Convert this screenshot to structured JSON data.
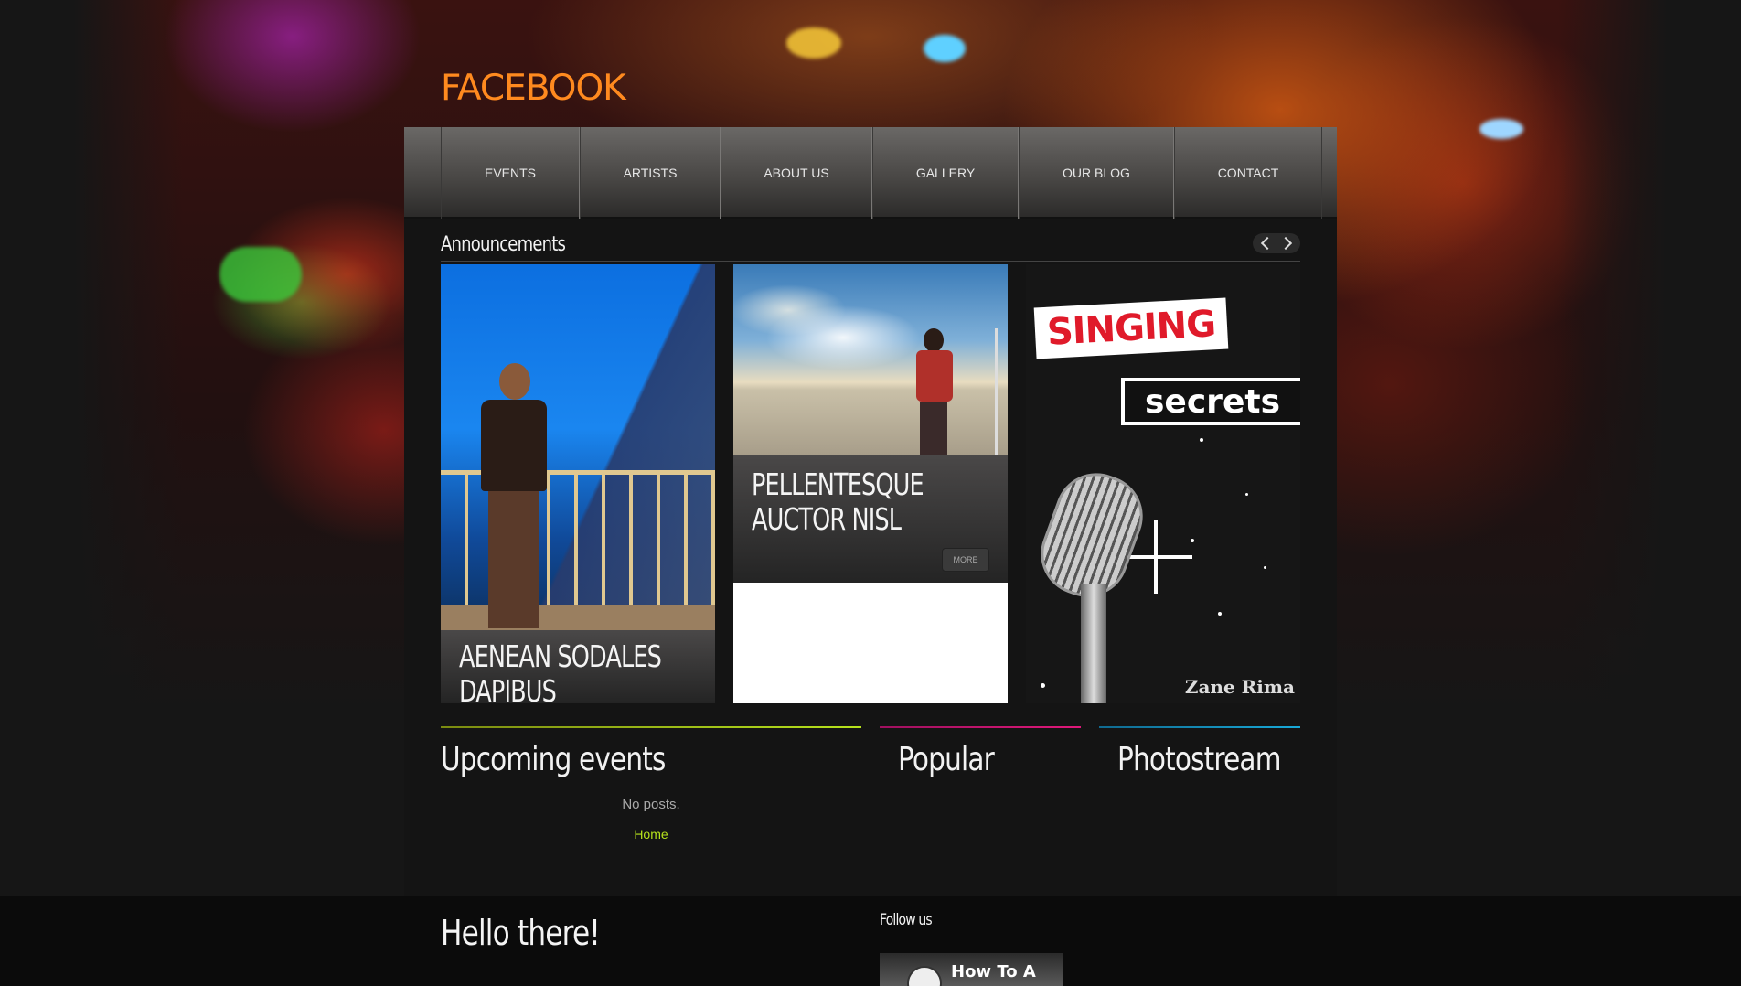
{
  "site": {
    "title": "FACEBOOK"
  },
  "nav": {
    "items": [
      {
        "label": "EVENTS"
      },
      {
        "label": "ARTISTS"
      },
      {
        "label": "ABOUT US"
      },
      {
        "label": "GALLERY"
      },
      {
        "label": "OUR BLOG"
      },
      {
        "label": "CONTACT"
      }
    ]
  },
  "announcements": {
    "heading": "Announcements",
    "cards": [
      {
        "title": "AENEAN SODALES DAPIBUS"
      },
      {
        "title": "PELLENTESQUE AUCTOR NISL",
        "more_label": "MORE"
      },
      {
        "sticker_top": "SINGING",
        "sticker_bottom": "secrets",
        "signature": "Zane Rima"
      }
    ]
  },
  "columns": {
    "events": {
      "heading": "Upcoming events",
      "empty_text": "No posts.",
      "home_link": "Home",
      "accent": "#b7e31c"
    },
    "popular": {
      "heading": "Popular",
      "accent": "#e0187a"
    },
    "photostream": {
      "heading": "Photostream",
      "accent": "#18a9d8"
    }
  },
  "footer": {
    "hello": "Hello there!",
    "follow": "Follow us",
    "video_title": "How To A"
  },
  "colors": {
    "brand": "#ff8a1f",
    "link": "#b7e31c"
  },
  "icons": {
    "prev": "chevron-left-icon",
    "next": "chevron-right-icon"
  }
}
